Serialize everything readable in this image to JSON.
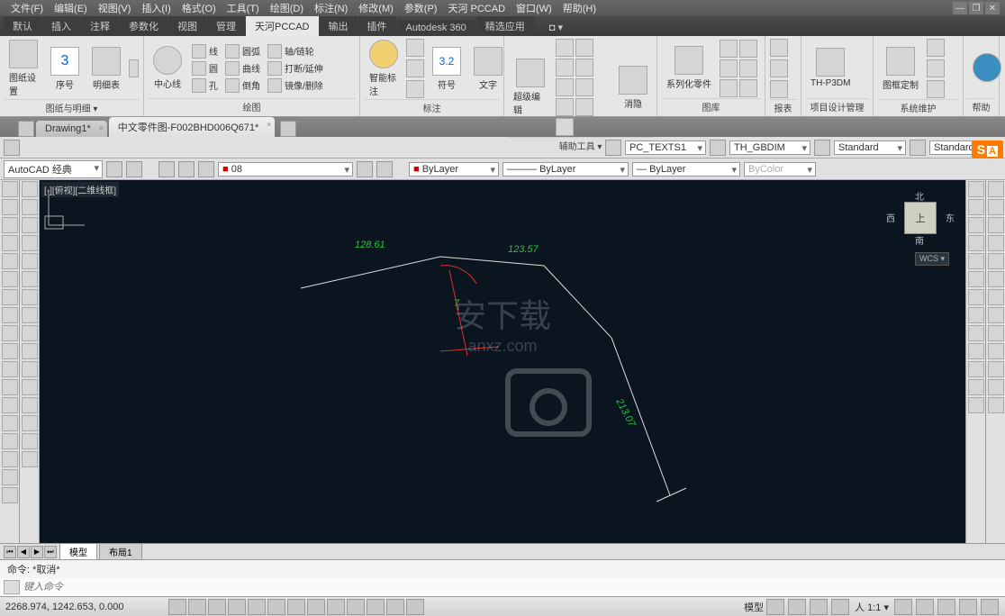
{
  "menus": [
    "文件(F)",
    "编辑(E)",
    "视图(V)",
    "插入(I)",
    "格式(O)",
    "工具(T)",
    "绘图(D)",
    "标注(N)",
    "修改(M)",
    "参数(P)",
    "天河 PCCAD",
    "窗口(W)",
    "帮助(H)"
  ],
  "ribbon_tabs": [
    "默认",
    "插入",
    "注释",
    "参数化",
    "视图",
    "管理",
    "天河PCCAD",
    "输出",
    "插件",
    "Autodesk 360",
    "精选应用"
  ],
  "ribbon_active": "天河PCCAD",
  "panels": {
    "p1": {
      "title": "图纸与明细 ▾",
      "items": [
        "图纸设置",
        "序号",
        "明细表"
      ]
    },
    "p2": {
      "title": "绘图",
      "col1": [
        "线",
        "圆",
        "孔"
      ],
      "col2": [
        "圆弧",
        "曲线",
        "倒角"
      ],
      "col3": [
        "轴/链轮",
        "打断/延伸",
        "镜像/删除"
      ],
      "center": "中心线"
    },
    "p3": {
      "title": "标注",
      "big": "智能标注",
      "dim": "3.2",
      "items": [
        "符号",
        "文字"
      ]
    },
    "p4": {
      "title": "辅助工具 ▾",
      "items": [
        "超级编辑",
        "消隐"
      ]
    },
    "p5": {
      "title": "图库",
      "items": [
        "系列化零件"
      ]
    },
    "p6": {
      "title": "报表"
    },
    "p7": {
      "title": "项目设计管理",
      "items": [
        "TH-P3DM"
      ]
    },
    "p8": {
      "title": "系统维护",
      "items": [
        "图框定制"
      ]
    },
    "p9": {
      "title": "帮助"
    }
  },
  "doc_tabs": [
    {
      "label": "Drawing1*"
    },
    {
      "label": "中文零件图-F002BHD006Q671*",
      "active": true
    }
  ],
  "prop1": {
    "textstyle": "PC_TEXTS1",
    "dimstyle": "TH_GBDIM",
    "tablestyle": "Standard",
    "mlstyle": "Standard"
  },
  "prop2": {
    "workspace": "AutoCAD 经典",
    "layer": "08",
    "color": "ByLayer",
    "ltype": "ByLayer",
    "lweight": "ByLayer",
    "plot": "ByColor"
  },
  "canvas_label": "[-][俯视][二维线框]",
  "dims": {
    "d1": "128.61",
    "d2": "123.57",
    "d3": "213.07",
    "d4": "7"
  },
  "viewcube": {
    "top": "上",
    "n": "北",
    "s": "南",
    "e": "东",
    "w": "西",
    "wcs": "WCS ▾"
  },
  "layout_tabs": [
    "模型",
    "布局1"
  ],
  "layout_active": "模型",
  "cmd_hist": "命令: *取消*",
  "cmd_placeholder": "键入命令",
  "coords": "2268.974, 1242.653, 0.000",
  "scale": "1:1",
  "status_mode": "模型",
  "watermark": "安下载\nanxz.com"
}
